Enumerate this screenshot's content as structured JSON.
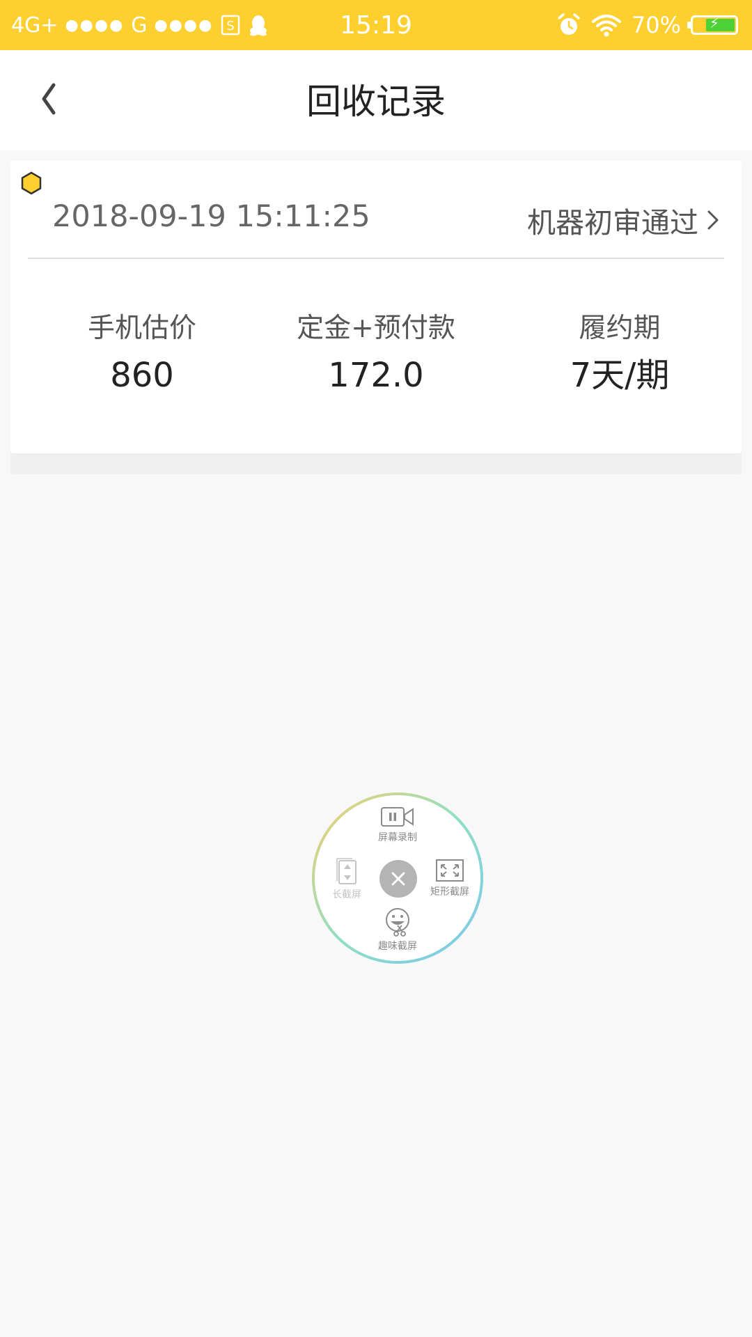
{
  "status_bar": {
    "network": "4G+",
    "network2": "G",
    "signal_dots": "●●●●",
    "time": "15:19",
    "battery_percent": "70%",
    "battery_level": 0.7,
    "icons": [
      "sim-card-icon",
      "qq-icon",
      "alarm-clock-icon",
      "wifi-icon",
      "battery-icon"
    ]
  },
  "header": {
    "title": "回收记录",
    "back_icon": "chevron-left-icon"
  },
  "record": {
    "marker_color": "#fed02f",
    "datetime": "2018-09-19 15:11:25",
    "status": "机器初审通过",
    "stats": [
      {
        "label": "手机估价",
        "value": "860"
      },
      {
        "label": "定金+预付款",
        "value": "172.0"
      },
      {
        "label": "履约期",
        "value": "7天/期"
      }
    ]
  },
  "screenshot_menu": {
    "items": {
      "record": "屏幕录制",
      "long": "长截屏",
      "rect": "矩形截屏",
      "fun": "趣味截屏"
    },
    "close_icon": "close-icon"
  },
  "colors": {
    "accent": "#fed02f",
    "background": "#f8f8f8"
  }
}
